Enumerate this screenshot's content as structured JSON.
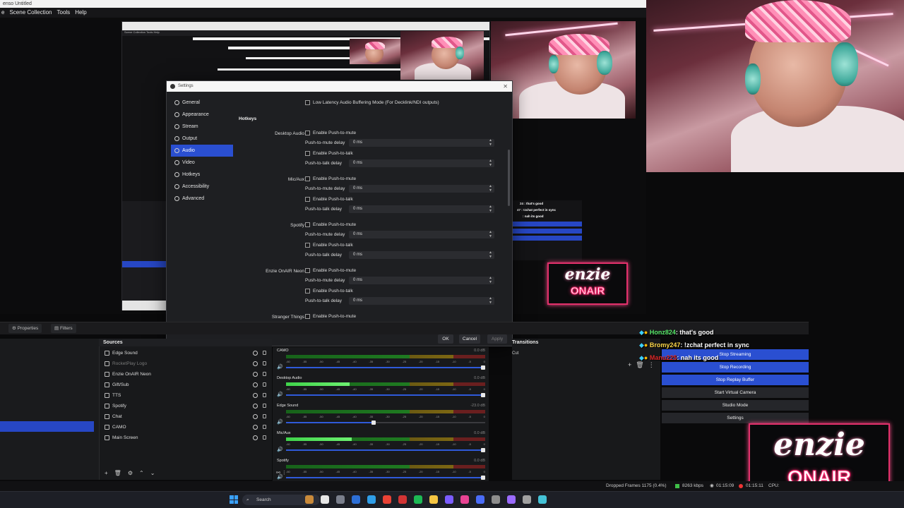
{
  "window": {
    "title": "enso Untitled"
  },
  "menu": [
    "e",
    "Scene Collection",
    "Tools",
    "Help"
  ],
  "nested": {
    "menu": "Scene Collection   Tools   Help"
  },
  "settings": {
    "title": "Settings",
    "nav": [
      {
        "label": "General",
        "icon": "gear-icon"
      },
      {
        "label": "Appearance",
        "icon": "palette-icon"
      },
      {
        "label": "Stream",
        "icon": "globe-icon"
      },
      {
        "label": "Output",
        "icon": "output-icon"
      },
      {
        "label": "Audio",
        "icon": "speaker-icon",
        "selected": true
      },
      {
        "label": "Video",
        "icon": "monitor-icon"
      },
      {
        "label": "Hotkeys",
        "icon": "keyboard-icon"
      },
      {
        "label": "Accessibility",
        "icon": "accessibility-icon"
      },
      {
        "label": "Advanced",
        "icon": "wrench-icon"
      }
    ],
    "low_latency": "Low Latency Audio Buffering Mode (For Decklink/NDI outputs)",
    "hotkeys_title": "Hotkeys",
    "enable_ptm": "Enable Push-to-mute",
    "ptm_delay": "Push-to-mute delay",
    "enable_ptt": "Enable Push-to-talk",
    "ptt_delay": "Push-to-talk delay",
    "delay_value": "0 ms",
    "devices": [
      "Desktop Audio",
      "Mic/Aux",
      "Spotify",
      "Enzie OnAIR Neon",
      "Stranger Things"
    ],
    "buttons": {
      "ok": "OK",
      "cancel": "Cancel",
      "apply": "Apply"
    }
  },
  "docks": {
    "properties": "Properties",
    "filters": "Filters"
  },
  "sources": {
    "title": "Sources",
    "items": [
      {
        "label": "Edge Sound",
        "dim": false
      },
      {
        "label": "RocketPlay Logo",
        "dim": true
      },
      {
        "label": "Enzie OnAIR Neon",
        "dim": false
      },
      {
        "label": "Gift/Sub",
        "dim": false
      },
      {
        "label": "TTS",
        "dim": false
      },
      {
        "label": "Spotify",
        "dim": false
      },
      {
        "label": "Chat",
        "dim": false
      },
      {
        "label": "CAMO",
        "dim": false
      },
      {
        "label": "Main Screen",
        "dim": false
      }
    ]
  },
  "mixer": {
    "ticks": [
      "-60",
      "-55",
      "-50",
      "-45",
      "-40",
      "-35",
      "-30",
      "-25",
      "-20",
      "-15",
      "-10",
      "-5",
      "0"
    ],
    "channels": [
      {
        "name": "CAMO",
        "db": "0.0 dB",
        "level": 0.0,
        "volume": 1.0
      },
      {
        "name": "Desktop Audio",
        "db": "0.0 dB",
        "level": 0.32,
        "volume": 1.0
      },
      {
        "name": "Edge Sound",
        "db": "-23.0 dB",
        "level": 0.0,
        "volume": 0.45
      },
      {
        "name": "Mic/Aux",
        "db": "0.0 dB",
        "level": 0.33,
        "volume": 1.0
      },
      {
        "name": "Spotify",
        "db": "0.0 dB",
        "level": 0.0,
        "volume": 1.0
      }
    ]
  },
  "transitions": {
    "title": "Transitions",
    "value": "Cut"
  },
  "controls": {
    "buttons": [
      {
        "label": "Stop Streaming",
        "active": true
      },
      {
        "label": "Stop Recording",
        "active": true
      },
      {
        "label": "Stop Replay Buffer",
        "active": true
      },
      {
        "label": "Start Virtual Camera",
        "active": false
      },
      {
        "label": "Studio Mode",
        "active": false
      },
      {
        "label": "Settings",
        "active": false
      }
    ]
  },
  "chat": [
    {
      "user": "Honz824",
      "msg": ": that's good",
      "color": "#58e86a"
    },
    {
      "user": "Bromy247",
      "msg": ": !zchat perfect in sync",
      "color": "#ffd84a"
    },
    {
      "user": "Manu225",
      "msg": ": nah its good",
      "color": "#e02a2a"
    }
  ],
  "mini_chat": [
    "24 : that's good",
    "47 : !zchat perfect in sync",
    ": nah its good"
  ],
  "status": {
    "dropped": "Dropped Frames 1175 (0.4%)",
    "bitrate": "8263 kbps",
    "live": "01:15:09",
    "rec": "01:15:11",
    "cpu": "CPU:"
  },
  "taskbar": {
    "search": "Search"
  },
  "logo": {
    "top": "enzie",
    "bottom": "ONAIR"
  },
  "colors": {
    "accent": "#2a4fd1",
    "neon": "#e2306b"
  }
}
